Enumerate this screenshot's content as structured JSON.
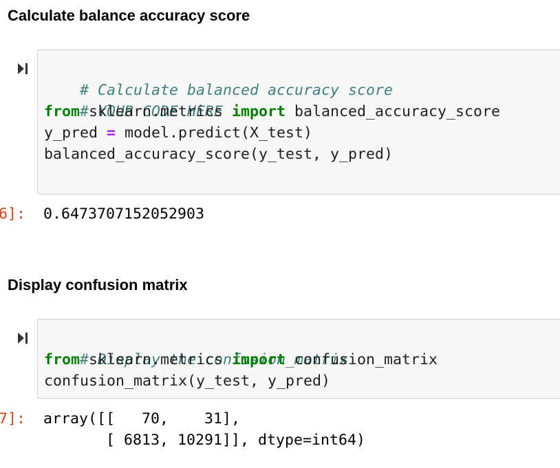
{
  "sections": [
    {
      "heading": "Calculate balance accuracy score",
      "code": {
        "comment1": "# Calculate balanced accuracy score",
        "comment2": "# YOUR CODE HERE",
        "line3_kw1": "from",
        "line3_mid": " sklearn.metrics ",
        "line3_kw2": "import",
        "line3_end": " balanced_accuracy_score",
        "line4_start": "y_pred ",
        "line4_op": "=",
        "line4_end": " model.predict(X_test)",
        "line5": "balanced_accuracy_score(y_test, y_pred)"
      },
      "prompt": "6]:",
      "output": [
        "0.6473707152052903"
      ]
    },
    {
      "heading": "Display confusion matrix",
      "code": {
        "comment1": "# Display the confusion_matrix",
        "line2_kw1": "from",
        "line2_mid": " sklearn.metrics ",
        "line2_kw2": "import",
        "line2_end": " confusion_matrix",
        "line3": "confusion_matrix(y_test, y_pred)"
      },
      "prompt": "7]:",
      "output": [
        "array([[   70,    31],",
        "       [ 6813, 10291]], dtype=int64)"
      ]
    }
  ],
  "icons": {
    "run_cell": "run-cell-icon"
  },
  "colors": {
    "comment": "#408080",
    "keyword": "#008000",
    "operator": "#aa22ff",
    "prompt": "#d84315",
    "cell_background": "#f7f7f7",
    "cell_border": "#cfcfcf"
  }
}
